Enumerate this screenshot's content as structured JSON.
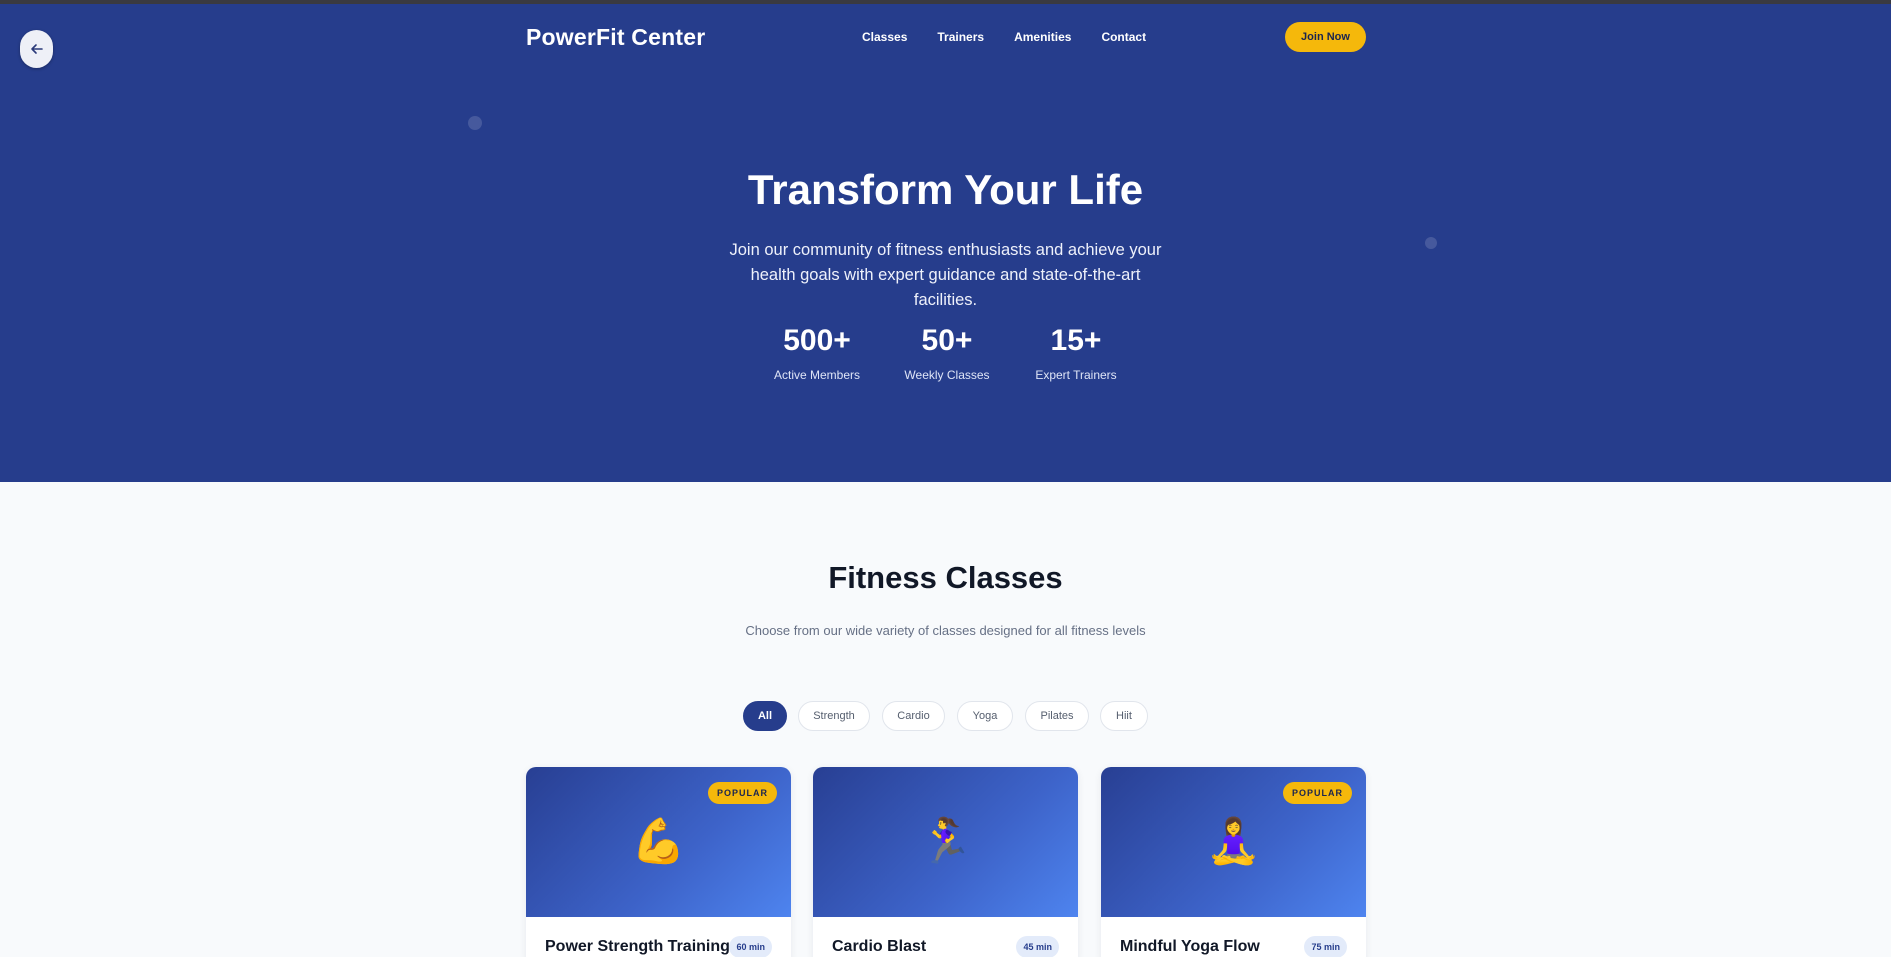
{
  "header": {
    "brand": "PowerFit Center",
    "nav": [
      "Classes",
      "Trainers",
      "Amenities",
      "Contact"
    ],
    "cta": "Join Now"
  },
  "hero": {
    "title": "Transform Your Life",
    "subtitle": "Join our community of fitness enthusiasts and achieve your health goals with expert guidance and state-of-the-art facilities.",
    "stats": [
      {
        "value": "500+",
        "label": "Active Members"
      },
      {
        "value": "50+",
        "label": "Weekly Classes"
      },
      {
        "value": "15+",
        "label": "Expert Trainers"
      }
    ]
  },
  "classes": {
    "title": "Fitness Classes",
    "subtitle": "Choose from our wide variety of classes designed for all fitness levels",
    "filters": [
      "All",
      "Strength",
      "Cardio",
      "Yoga",
      "Pilates",
      "Hiit"
    ],
    "active_filter": "All",
    "cards": [
      {
        "icon": "flexed-biceps-icon",
        "emoji": "💪",
        "badge": "POPULAR",
        "title": "Power Strength Training",
        "duration": "60 min"
      },
      {
        "icon": "running-woman-icon",
        "emoji": "🏃‍♀️",
        "badge": "",
        "title": "Cardio Blast",
        "duration": "45 min"
      },
      {
        "icon": "meditating-woman-icon",
        "emoji": "🧘‍♀️",
        "badge": "POPULAR",
        "title": "Mindful Yoga Flow",
        "duration": "75 min"
      }
    ]
  },
  "colors": {
    "primary": "#263d8c",
    "accent": "#f5b80b",
    "background": "#f8fafc"
  }
}
